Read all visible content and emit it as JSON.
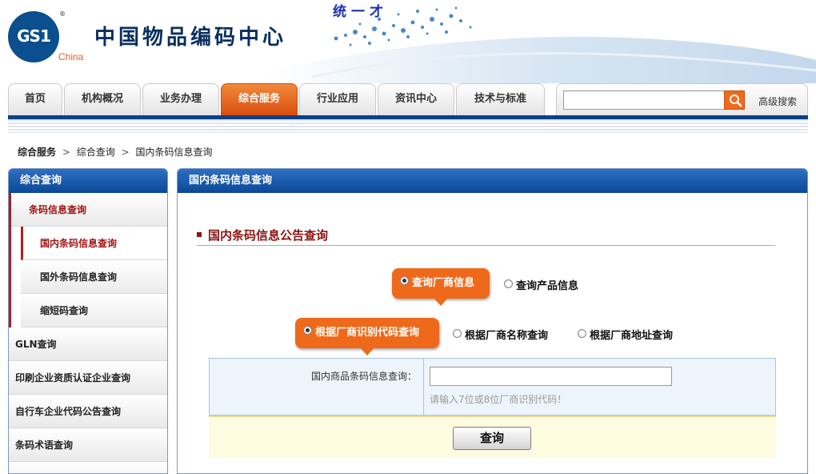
{
  "header": {
    "logo_text": "GS1",
    "logo_reg": "®",
    "logo_region": "China",
    "org_name": "中国物品编码中心",
    "slogan": "统一才"
  },
  "nav": {
    "tabs": [
      "首页",
      "机构概况",
      "业务办理",
      "综合服务",
      "行业应用",
      "资讯中心",
      "技术与标准"
    ],
    "active_tab": "综合服务",
    "search_value": "",
    "advanced_search": "高级搜索"
  },
  "breadcrumb": {
    "level1": "综合服务",
    "sep1": ">",
    "level2": "综合查询",
    "sep2": ">",
    "current": "国内条码信息查询"
  },
  "sidebar": {
    "title": "综合查询",
    "group_label": "条码信息查询",
    "sub_items": [
      "国内条码信息查询",
      "国外条码信息查询",
      "缩短码查询"
    ],
    "selected_sub": "国内条码信息查询",
    "items": [
      "GLN查询",
      "印刷企业资质认证企业查询",
      "自行车企业代码公告查询",
      "条码术语查询"
    ]
  },
  "main": {
    "panel_title": "国内条码信息查询",
    "section_title": "国内条码信息公告查询",
    "query_types": {
      "selected": "查询厂商信息",
      "other": "查询产品信息"
    },
    "query_modes": {
      "selected": "根据厂商识别代码查询",
      "option2": "根据厂商名称查询",
      "option3": "根据厂商地址查询"
    },
    "form": {
      "label": "国内商品条码信息查询：",
      "value": "",
      "hint": "请输入7位或8位厂商识别代码！"
    },
    "submit_label": "查询"
  },
  "colors": {
    "nav_active": "#ee6a1a",
    "panel_header": "#0b4796",
    "section_title": "#8b1414",
    "sidebar_accent": "#b01e1e"
  }
}
